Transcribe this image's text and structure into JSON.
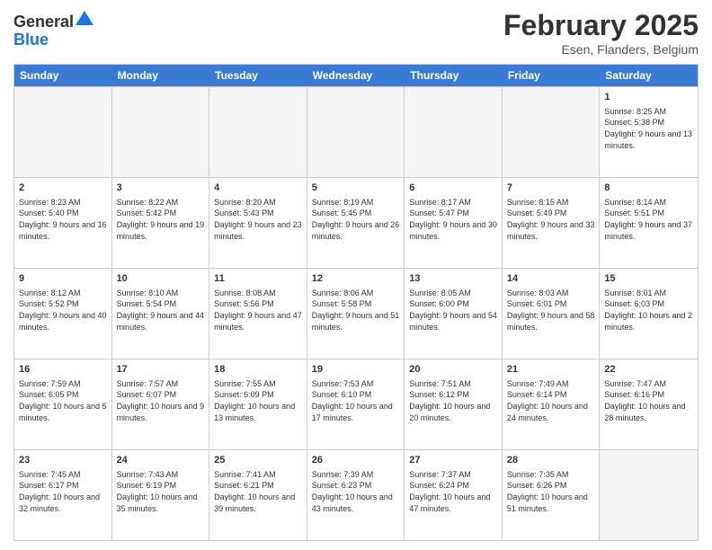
{
  "header": {
    "logo_general": "General",
    "logo_blue": "Blue",
    "month_title": "February 2025",
    "location": "Esen, Flanders, Belgium"
  },
  "calendar": {
    "days_of_week": [
      "Sunday",
      "Monday",
      "Tuesday",
      "Wednesday",
      "Thursday",
      "Friday",
      "Saturday"
    ],
    "rows": [
      [
        {
          "day": "",
          "info": ""
        },
        {
          "day": "",
          "info": ""
        },
        {
          "day": "",
          "info": ""
        },
        {
          "day": "",
          "info": ""
        },
        {
          "day": "",
          "info": ""
        },
        {
          "day": "",
          "info": ""
        },
        {
          "day": "1",
          "info": "Sunrise: 8:25 AM\nSunset: 5:38 PM\nDaylight: 9 hours and 13 minutes."
        }
      ],
      [
        {
          "day": "2",
          "info": "Sunrise: 8:23 AM\nSunset: 5:40 PM\nDaylight: 9 hours and 16 minutes."
        },
        {
          "day": "3",
          "info": "Sunrise: 8:22 AM\nSunset: 5:42 PM\nDaylight: 9 hours and 19 minutes."
        },
        {
          "day": "4",
          "info": "Sunrise: 8:20 AM\nSunset: 5:43 PM\nDaylight: 9 hours and 23 minutes."
        },
        {
          "day": "5",
          "info": "Sunrise: 8:19 AM\nSunset: 5:45 PM\nDaylight: 9 hours and 26 minutes."
        },
        {
          "day": "6",
          "info": "Sunrise: 8:17 AM\nSunset: 5:47 PM\nDaylight: 9 hours and 30 minutes."
        },
        {
          "day": "7",
          "info": "Sunrise: 8:15 AM\nSunset: 5:49 PM\nDaylight: 9 hours and 33 minutes."
        },
        {
          "day": "8",
          "info": "Sunrise: 8:14 AM\nSunset: 5:51 PM\nDaylight: 9 hours and 37 minutes."
        }
      ],
      [
        {
          "day": "9",
          "info": "Sunrise: 8:12 AM\nSunset: 5:52 PM\nDaylight: 9 hours and 40 minutes."
        },
        {
          "day": "10",
          "info": "Sunrise: 8:10 AM\nSunset: 5:54 PM\nDaylight: 9 hours and 44 minutes."
        },
        {
          "day": "11",
          "info": "Sunrise: 8:08 AM\nSunset: 5:56 PM\nDaylight: 9 hours and 47 minutes."
        },
        {
          "day": "12",
          "info": "Sunrise: 8:06 AM\nSunset: 5:58 PM\nDaylight: 9 hours and 51 minutes."
        },
        {
          "day": "13",
          "info": "Sunrise: 8:05 AM\nSunset: 6:00 PM\nDaylight: 9 hours and 54 minutes."
        },
        {
          "day": "14",
          "info": "Sunrise: 8:03 AM\nSunset: 6:01 PM\nDaylight: 9 hours and 58 minutes."
        },
        {
          "day": "15",
          "info": "Sunrise: 8:01 AM\nSunset: 6:03 PM\nDaylight: 10 hours and 2 minutes."
        }
      ],
      [
        {
          "day": "16",
          "info": "Sunrise: 7:59 AM\nSunset: 6:05 PM\nDaylight: 10 hours and 5 minutes."
        },
        {
          "day": "17",
          "info": "Sunrise: 7:57 AM\nSunset: 6:07 PM\nDaylight: 10 hours and 9 minutes."
        },
        {
          "day": "18",
          "info": "Sunrise: 7:55 AM\nSunset: 6:09 PM\nDaylight: 10 hours and 13 minutes."
        },
        {
          "day": "19",
          "info": "Sunrise: 7:53 AM\nSunset: 6:10 PM\nDaylight: 10 hours and 17 minutes."
        },
        {
          "day": "20",
          "info": "Sunrise: 7:51 AM\nSunset: 6:12 PM\nDaylight: 10 hours and 20 minutes."
        },
        {
          "day": "21",
          "info": "Sunrise: 7:49 AM\nSunset: 6:14 PM\nDaylight: 10 hours and 24 minutes."
        },
        {
          "day": "22",
          "info": "Sunrise: 7:47 AM\nSunset: 6:16 PM\nDaylight: 10 hours and 28 minutes."
        }
      ],
      [
        {
          "day": "23",
          "info": "Sunrise: 7:45 AM\nSunset: 6:17 PM\nDaylight: 10 hours and 32 minutes."
        },
        {
          "day": "24",
          "info": "Sunrise: 7:43 AM\nSunset: 6:19 PM\nDaylight: 10 hours and 35 minutes."
        },
        {
          "day": "25",
          "info": "Sunrise: 7:41 AM\nSunset: 6:21 PM\nDaylight: 10 hours and 39 minutes."
        },
        {
          "day": "26",
          "info": "Sunrise: 7:39 AM\nSunset: 6:23 PM\nDaylight: 10 hours and 43 minutes."
        },
        {
          "day": "27",
          "info": "Sunrise: 7:37 AM\nSunset: 6:24 PM\nDaylight: 10 hours and 47 minutes."
        },
        {
          "day": "28",
          "info": "Sunrise: 7:35 AM\nSunset: 6:26 PM\nDaylight: 10 hours and 51 minutes."
        },
        {
          "day": "",
          "info": ""
        }
      ]
    ]
  }
}
